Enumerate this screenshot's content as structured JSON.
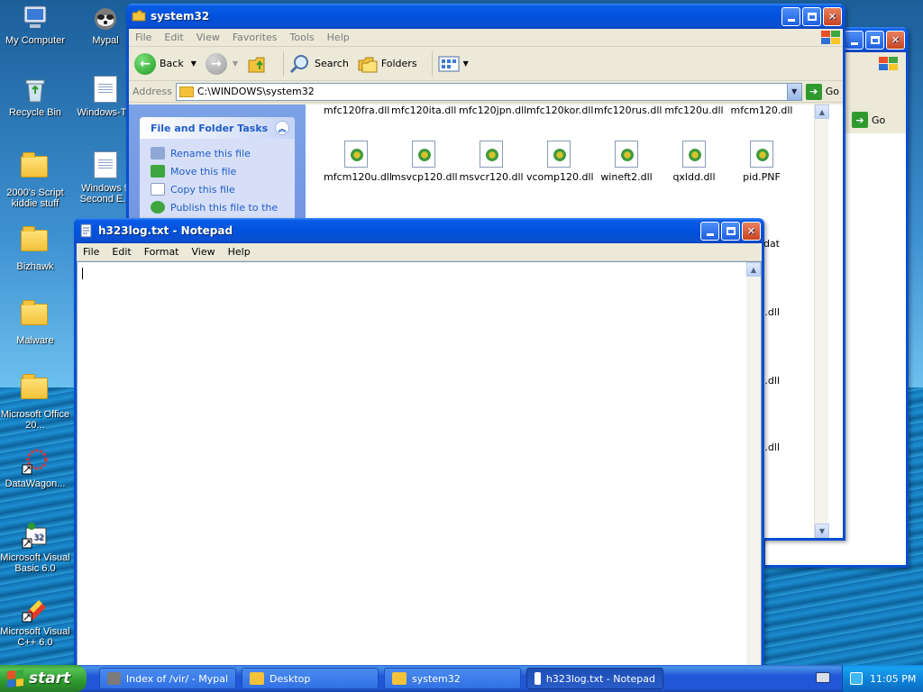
{
  "desktop": {
    "icons": [
      {
        "label": "My Computer"
      },
      {
        "label": "Mypal"
      },
      {
        "label": "Recycle Bin"
      },
      {
        "label": "Windows-Tin"
      },
      {
        "label": "2000's Script kiddie stuff"
      },
      {
        "label": "Windows 9 Second E..."
      },
      {
        "label": "Bizhawk"
      },
      {
        "label": "Malware"
      },
      {
        "label": "Microsoft Office 20..."
      },
      {
        "label": "DataWagon..."
      },
      {
        "label": "Microsoft Visual Basic 6.0"
      },
      {
        "label": "Microsoft Visual C++ 6.0"
      }
    ]
  },
  "explorer": {
    "title": "system32",
    "menu": [
      "File",
      "Edit",
      "View",
      "Favorites",
      "Tools",
      "Help"
    ],
    "toolbar": {
      "back": "Back",
      "search": "Search",
      "folders": "Folders"
    },
    "address_label": "Address",
    "address_value": "C:\\WINDOWS\\system32",
    "go": "Go",
    "task_pane": {
      "header": "File and Folder Tasks",
      "items": [
        "Rename this file",
        "Move this file",
        "Copy this file",
        "Publish this file to the"
      ]
    },
    "files_row1": [
      "mfc120fra.dll",
      "mfc120ita.dll",
      "mfc120jpn.dll",
      "mfc120kor.dll",
      "mfc120rus.dll",
      "mfc120u.dll",
      "mfcm120.dll"
    ],
    "files_row2": [
      "mfcm120u.dll",
      "msvcp120.dll",
      "msvcr120.dll",
      "vcomp120.dll",
      "wineft2.dll",
      "qxldd.dll",
      "pid.PNF"
    ],
    "files_partial": [
      "s.dat",
      "p.dll",
      "re.dll",
      "d.dll"
    ]
  },
  "back_window": {
    "go": "Go"
  },
  "notepad": {
    "title": "h323log.txt - Notepad",
    "menu": [
      "File",
      "Edit",
      "Format",
      "View",
      "Help"
    ]
  },
  "taskbar": {
    "start": "start",
    "buttons": [
      "Index of /vir/ - Mypal",
      "Desktop",
      "system32",
      "h323log.txt - Notepad"
    ],
    "clock": "11:05 PM"
  }
}
